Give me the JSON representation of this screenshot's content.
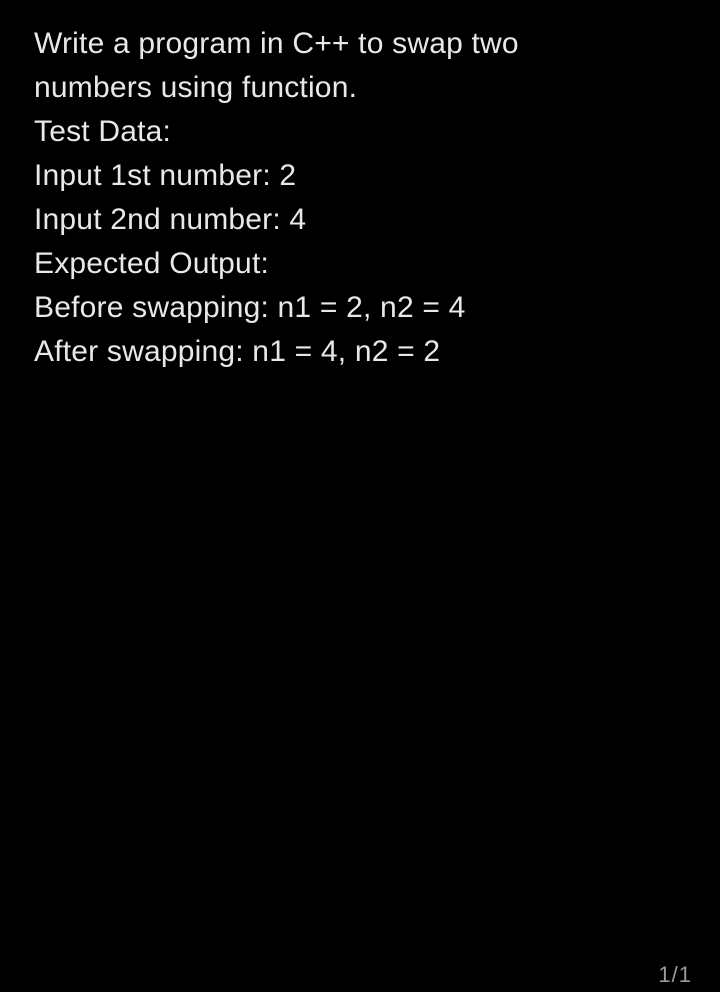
{
  "lines": {
    "l0": "Write a program in C++ to swap two",
    "l1": "numbers using function.",
    "l2": "Test Data:",
    "l3": "Input 1st number: 2",
    "l4": "Input 2nd number: 4",
    "l5": "Expected Output:",
    "l6": "Before swapping: n1 = 2, n2 = 4",
    "l7": "After swapping: n1 = 4, n2 = 2"
  },
  "page_indicator": "1/1"
}
